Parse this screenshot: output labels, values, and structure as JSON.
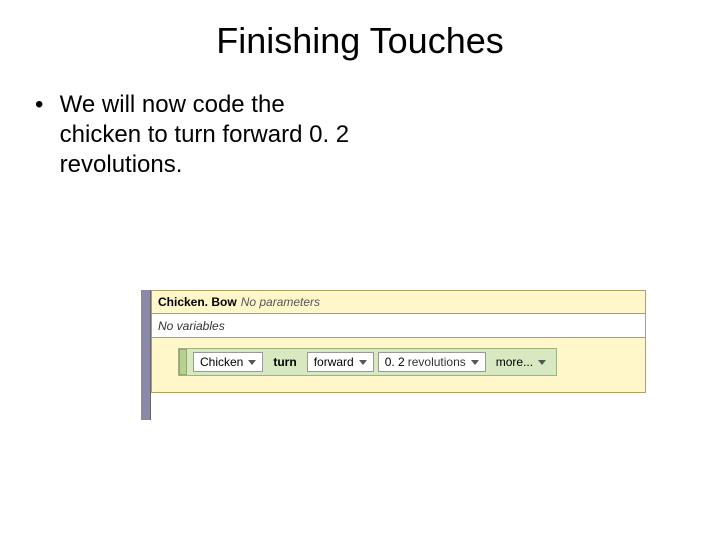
{
  "title": "Finishing Touches",
  "bullet": "We will now code the chicken to turn forward 0. 2 revolutions.",
  "editor": {
    "method_name": "Chicken. Bow",
    "params_label": "No parameters",
    "vars_label": "No variables",
    "stmt": {
      "object": "Chicken",
      "action": "turn",
      "direction": "forward",
      "amount": "0. 2",
      "amount_unit": "revolutions",
      "more": "more..."
    }
  }
}
